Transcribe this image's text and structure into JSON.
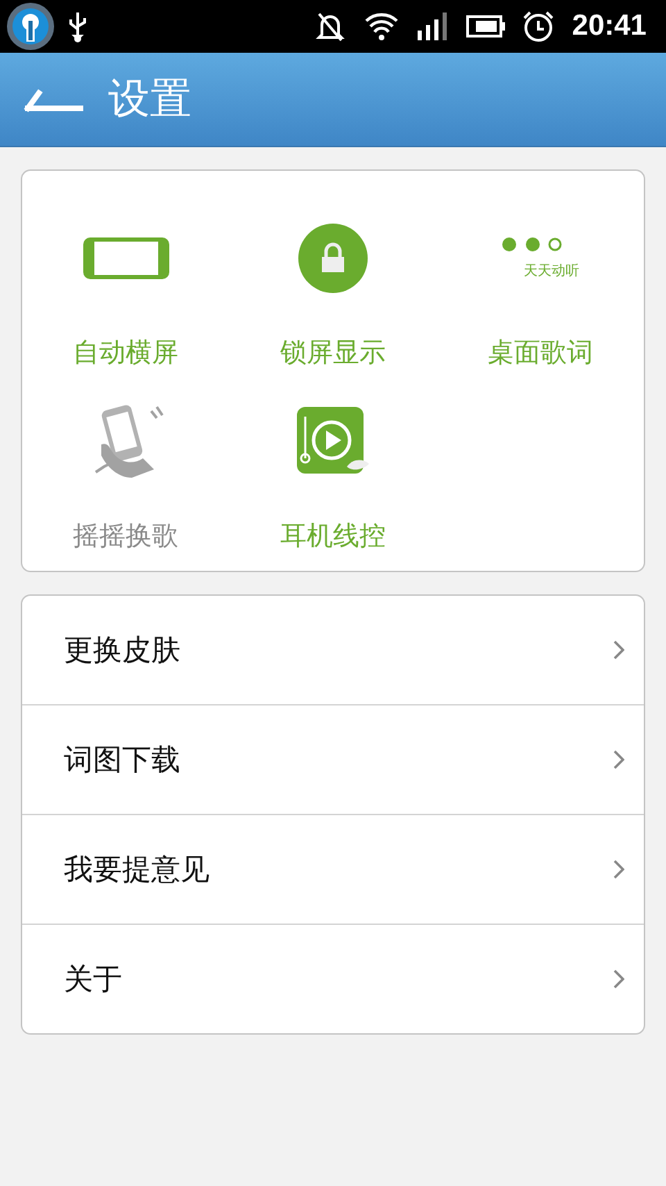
{
  "status_bar": {
    "time": "20:41"
  },
  "header": {
    "title": "设置"
  },
  "toggles": [
    {
      "kind": "rotate",
      "label": "自动横屏",
      "on": true
    },
    {
      "kind": "lock",
      "label": "锁屏显示",
      "on": true
    },
    {
      "kind": "lyrics",
      "label": "桌面歌词",
      "on": true,
      "icon_text": "天天动听"
    },
    {
      "kind": "shake",
      "label": "摇摇换歌",
      "on": false
    },
    {
      "kind": "headset",
      "label": "耳机线控",
      "on": true
    }
  ],
  "menu": [
    {
      "label": "更换皮肤"
    },
    {
      "label": "词图下载"
    },
    {
      "label": "我要提意见"
    },
    {
      "label": "关于"
    }
  ]
}
